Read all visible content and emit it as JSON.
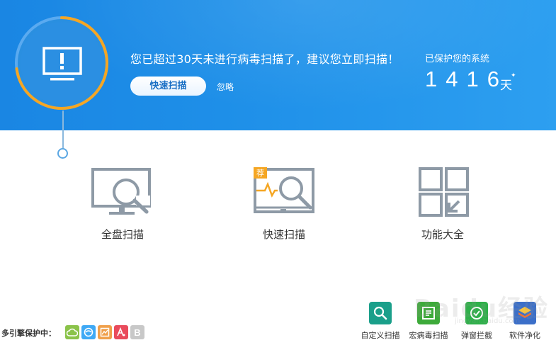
{
  "alert": {
    "message": "您已超过30天未进行病毒扫描了，建议您立即扫描！",
    "quick_scan_label": "快速扫描",
    "ignore_label": "忽略"
  },
  "protection": {
    "label": "已保护您的系统",
    "days": "1416",
    "unit": "天"
  },
  "features": {
    "full_scan": "全盘扫描",
    "quick_scan": "快速扫描",
    "quick_scan_badge": "荐",
    "all_tools": "功能大全"
  },
  "engines": {
    "label": "多引擎保护中：",
    "icons": [
      "cloud-engine-icon",
      "qvm-engine-icon",
      "system-repair-engine-icon",
      "avira-engine-icon",
      "bitdefender-engine-icon"
    ],
    "colors": [
      "#8bc34a",
      "#3fa9f5",
      "#f0a04b",
      "#e94b5c",
      "#c8c8c8"
    ],
    "bitdefender_letter": "B"
  },
  "tools": [
    {
      "label": "自定义扫描",
      "icon": "custom-scan-icon",
      "color": "#1a9f8a"
    },
    {
      "label": "宏病毒扫描",
      "icon": "macro-virus-scan-icon",
      "color": "#3daa3a"
    },
    {
      "label": "弹窗拦截",
      "icon": "popup-block-icon",
      "color": "#2fb04a"
    },
    {
      "label": "软件净化",
      "icon": "software-purify-icon",
      "color": "#3b6fc9"
    }
  ],
  "watermark": {
    "text": "Baidu经验",
    "sub": "jingyan.baidu.com"
  },
  "theme": {
    "banner_blue": "#1e8fe8",
    "ring_orange": "#f5a623",
    "icon_gray": "#8e9aa6"
  }
}
